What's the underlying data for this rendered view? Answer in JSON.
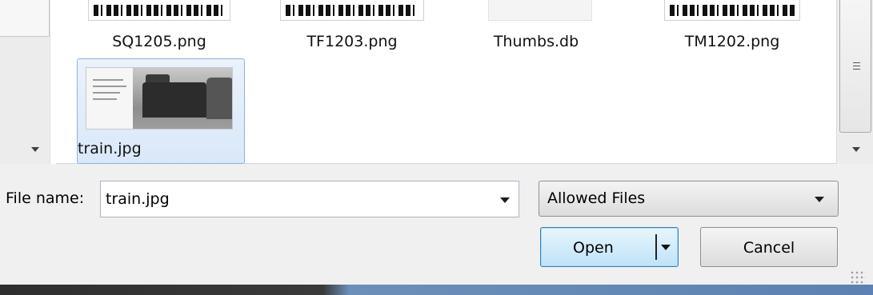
{
  "files": [
    {
      "name": "SQ1205.png"
    },
    {
      "name": "TF1203.png"
    },
    {
      "name": "Thumbs.db"
    },
    {
      "name": "TM1202.png"
    },
    {
      "name": "train.jpg",
      "selected": true
    }
  ],
  "form": {
    "file_name_label": "File name:",
    "file_name_value": "train.jpg",
    "file_type": "Allowed Files",
    "open_label": "Open",
    "cancel_label": "Cancel"
  },
  "icons": {
    "scroll_down": "chevron-down-icon",
    "dropdown": "dropdown-arrow-icon",
    "grip": "resize-grip-icon"
  },
  "colors": {
    "selection_bg": "#d9e8f9",
    "selection_border": "#8db2e3",
    "default_button": "#bfe3f8"
  }
}
